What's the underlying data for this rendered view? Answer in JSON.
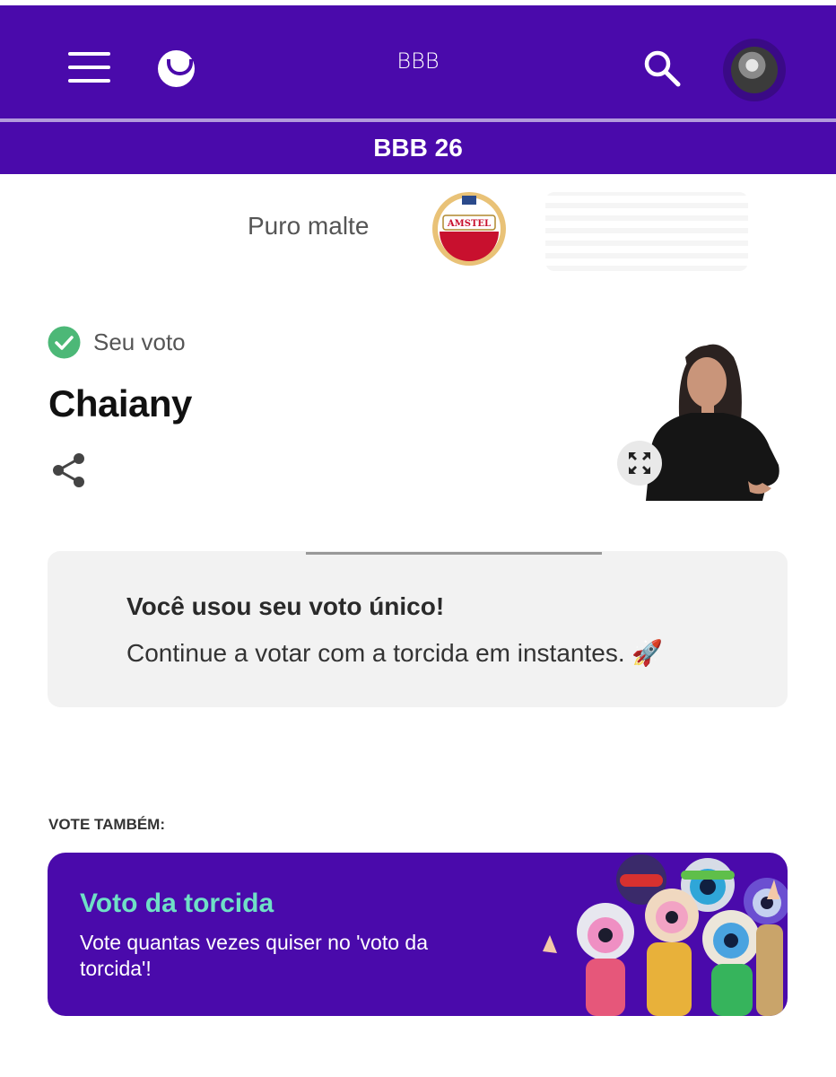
{
  "header": {
    "title": "BBB",
    "subtitle": "BBB 26"
  },
  "sponsor": {
    "text": "Puro malte",
    "logo_text": "AMSTEL"
  },
  "vote": {
    "status_label": "Seu voto",
    "candidate_name": "Chaiany"
  },
  "notice": {
    "title": "Você usou seu voto único!",
    "message": "Continue a votar com a torcida em instantes. 🚀"
  },
  "also": {
    "label": "VOTE TAMBÉM:"
  },
  "torcida": {
    "title": "Voto da torcida",
    "description": "Vote quantas vezes quiser no 'voto da torcida'!"
  },
  "colors": {
    "brand_purple": "#4a0aab",
    "accent_teal": "#6fe0c6",
    "check_green": "#4cb877"
  }
}
